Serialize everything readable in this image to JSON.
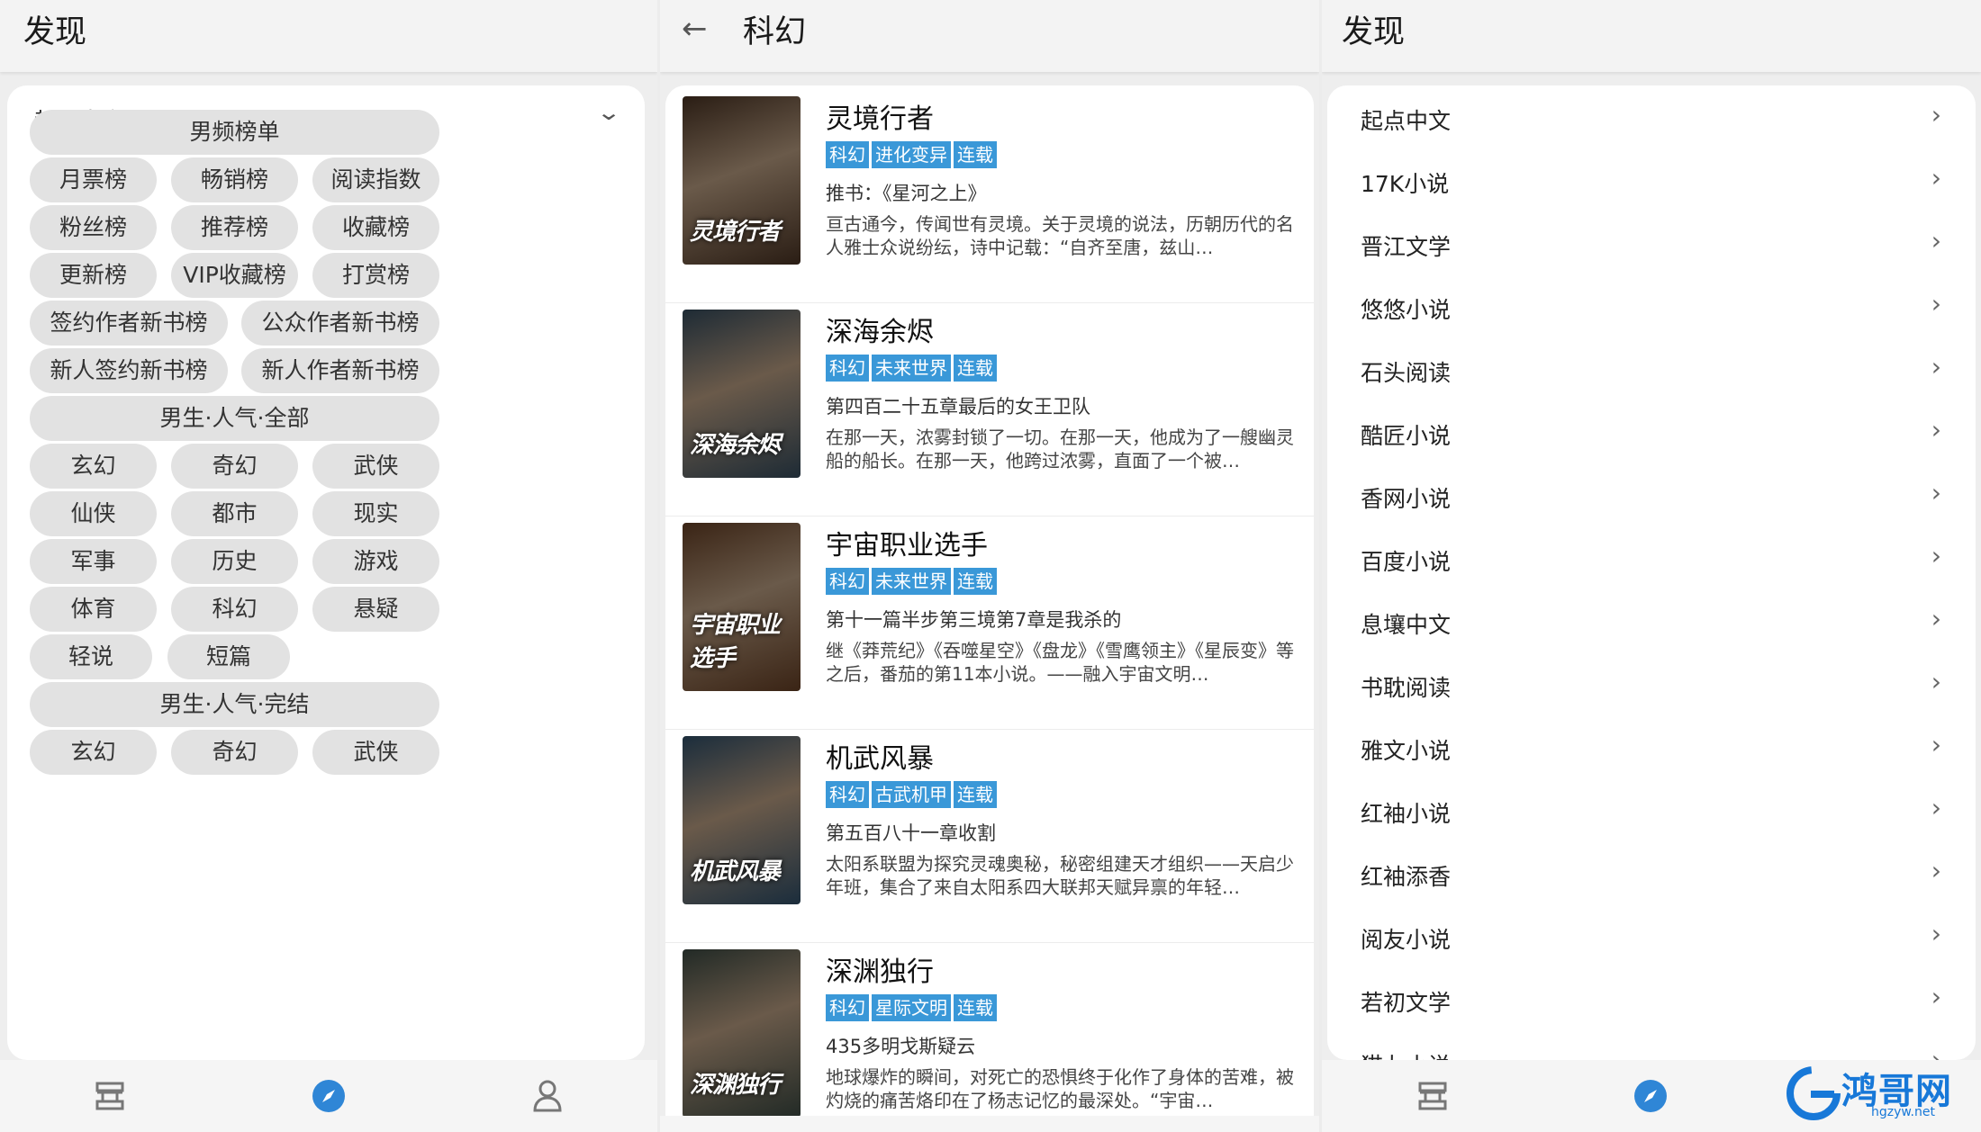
{
  "left_panel": {
    "title": "发现",
    "source_name": "起点中文",
    "chips": [
      {
        "label": "男频榜单"
      },
      {
        "label": "月票榜"
      },
      {
        "label": "畅销榜"
      },
      {
        "label": "阅读指数"
      },
      {
        "label": "粉丝榜"
      },
      {
        "label": "推荐榜"
      },
      {
        "label": "收藏榜"
      },
      {
        "label": "更新榜"
      },
      {
        "label": "VIP收藏榜"
      },
      {
        "label": "打赏榜"
      },
      {
        "label": "签约作者新书榜"
      },
      {
        "label": "公众作者新书榜"
      },
      {
        "label": "新人签约新书榜"
      },
      {
        "label": "新人作者新书榜"
      },
      {
        "label": "男生·人气·全部"
      },
      {
        "label": "玄幻"
      },
      {
        "label": "奇幻"
      },
      {
        "label": "武侠"
      },
      {
        "label": "仙侠"
      },
      {
        "label": "都市"
      },
      {
        "label": "现实"
      },
      {
        "label": "军事"
      },
      {
        "label": "历史"
      },
      {
        "label": "游戏"
      },
      {
        "label": "体育"
      },
      {
        "label": "科幻"
      },
      {
        "label": "悬疑"
      },
      {
        "label": "轻说"
      },
      {
        "label": "短篇"
      },
      {
        "label": "男生·人气·完结"
      },
      {
        "label": "玄幻"
      },
      {
        "label": "奇幻"
      },
      {
        "label": "武侠"
      }
    ]
  },
  "middle_panel": {
    "title": "科幻",
    "books": [
      {
        "title": "灵境行者",
        "cover_text": "灵境行者",
        "tags": [
          "科幻",
          "进化变异",
          "连载"
        ],
        "latest": "推书：《星河之上》",
        "intro": "亘古通今，传闻世有灵境。关于灵境的说法，历朝历代的名人雅士众说纷纭，诗中记载：“自齐至唐，兹山…",
        "cover_color": "#2a1d14"
      },
      {
        "title": "深海余烬",
        "cover_text": "深海余烬",
        "tags": [
          "科幻",
          "未来世界",
          "连载"
        ],
        "latest": "第四百二十五章最后的女王卫队",
        "intro": "在那一天，浓雾封锁了一切。在那一天，他成为了一艘幽灵船的船长。在那一天，他跨过浓雾，直面了一个被…",
        "cover_color": "#1e2b35"
      },
      {
        "title": "宇宙职业选手",
        "cover_text": "宇宙职业选手",
        "tags": [
          "科幻",
          "未来世界",
          "连载"
        ],
        "latest": "第十一篇半步第三境第7章是我杀的",
        "intro": "继《莽荒纪》《吞噬星空》《盘龙》《雪鹰领主》《星辰变》等之后，番茄的第11本小说。——融入宇宙文明…",
        "cover_color": "#3a2415"
      },
      {
        "title": "机武风暴",
        "cover_text": "机武风暴",
        "tags": [
          "科幻",
          "古武机甲",
          "连载"
        ],
        "latest": "第五百八十一章收割",
        "intro": "太阳系联盟为探究灵魂奥秘，秘密组建天才组织——天启少年班，集合了来自太阳系四大联邦天赋异禀的年轻…",
        "cover_color": "#1b2d3c"
      },
      {
        "title": "深渊独行",
        "cover_text": "深渊独行",
        "tags": [
          "科幻",
          "星际文明",
          "连载"
        ],
        "latest": "435多明戈斯疑云",
        "intro": "地球爆炸的瞬间，对死亡的恐惧终于化作了身体的苦难，被灼烧的痛苦烙印在了杨志记忆的最深处。“宇宙…",
        "cover_color": "#222a26"
      }
    ]
  },
  "right_panel": {
    "title": "发现",
    "sources": [
      "起点中文",
      "17K小说",
      "晋江文学",
      "悠悠小说",
      "石头阅读",
      "酷匠小说",
      "香网小说",
      "百度小说",
      "息壤中文",
      "书耽阅读",
      "雅文小说",
      "红袖小说",
      "红袖添香",
      "阅友小说",
      "若初文学",
      "猫九小说"
    ]
  },
  "watermark": {
    "text": "鸿哥网",
    "sub": "hgzyw.net"
  },
  "colors": {
    "accent": "#3a98d8",
    "nav_active": "#2f86d6",
    "chip_bg": "#e2e2e2"
  }
}
